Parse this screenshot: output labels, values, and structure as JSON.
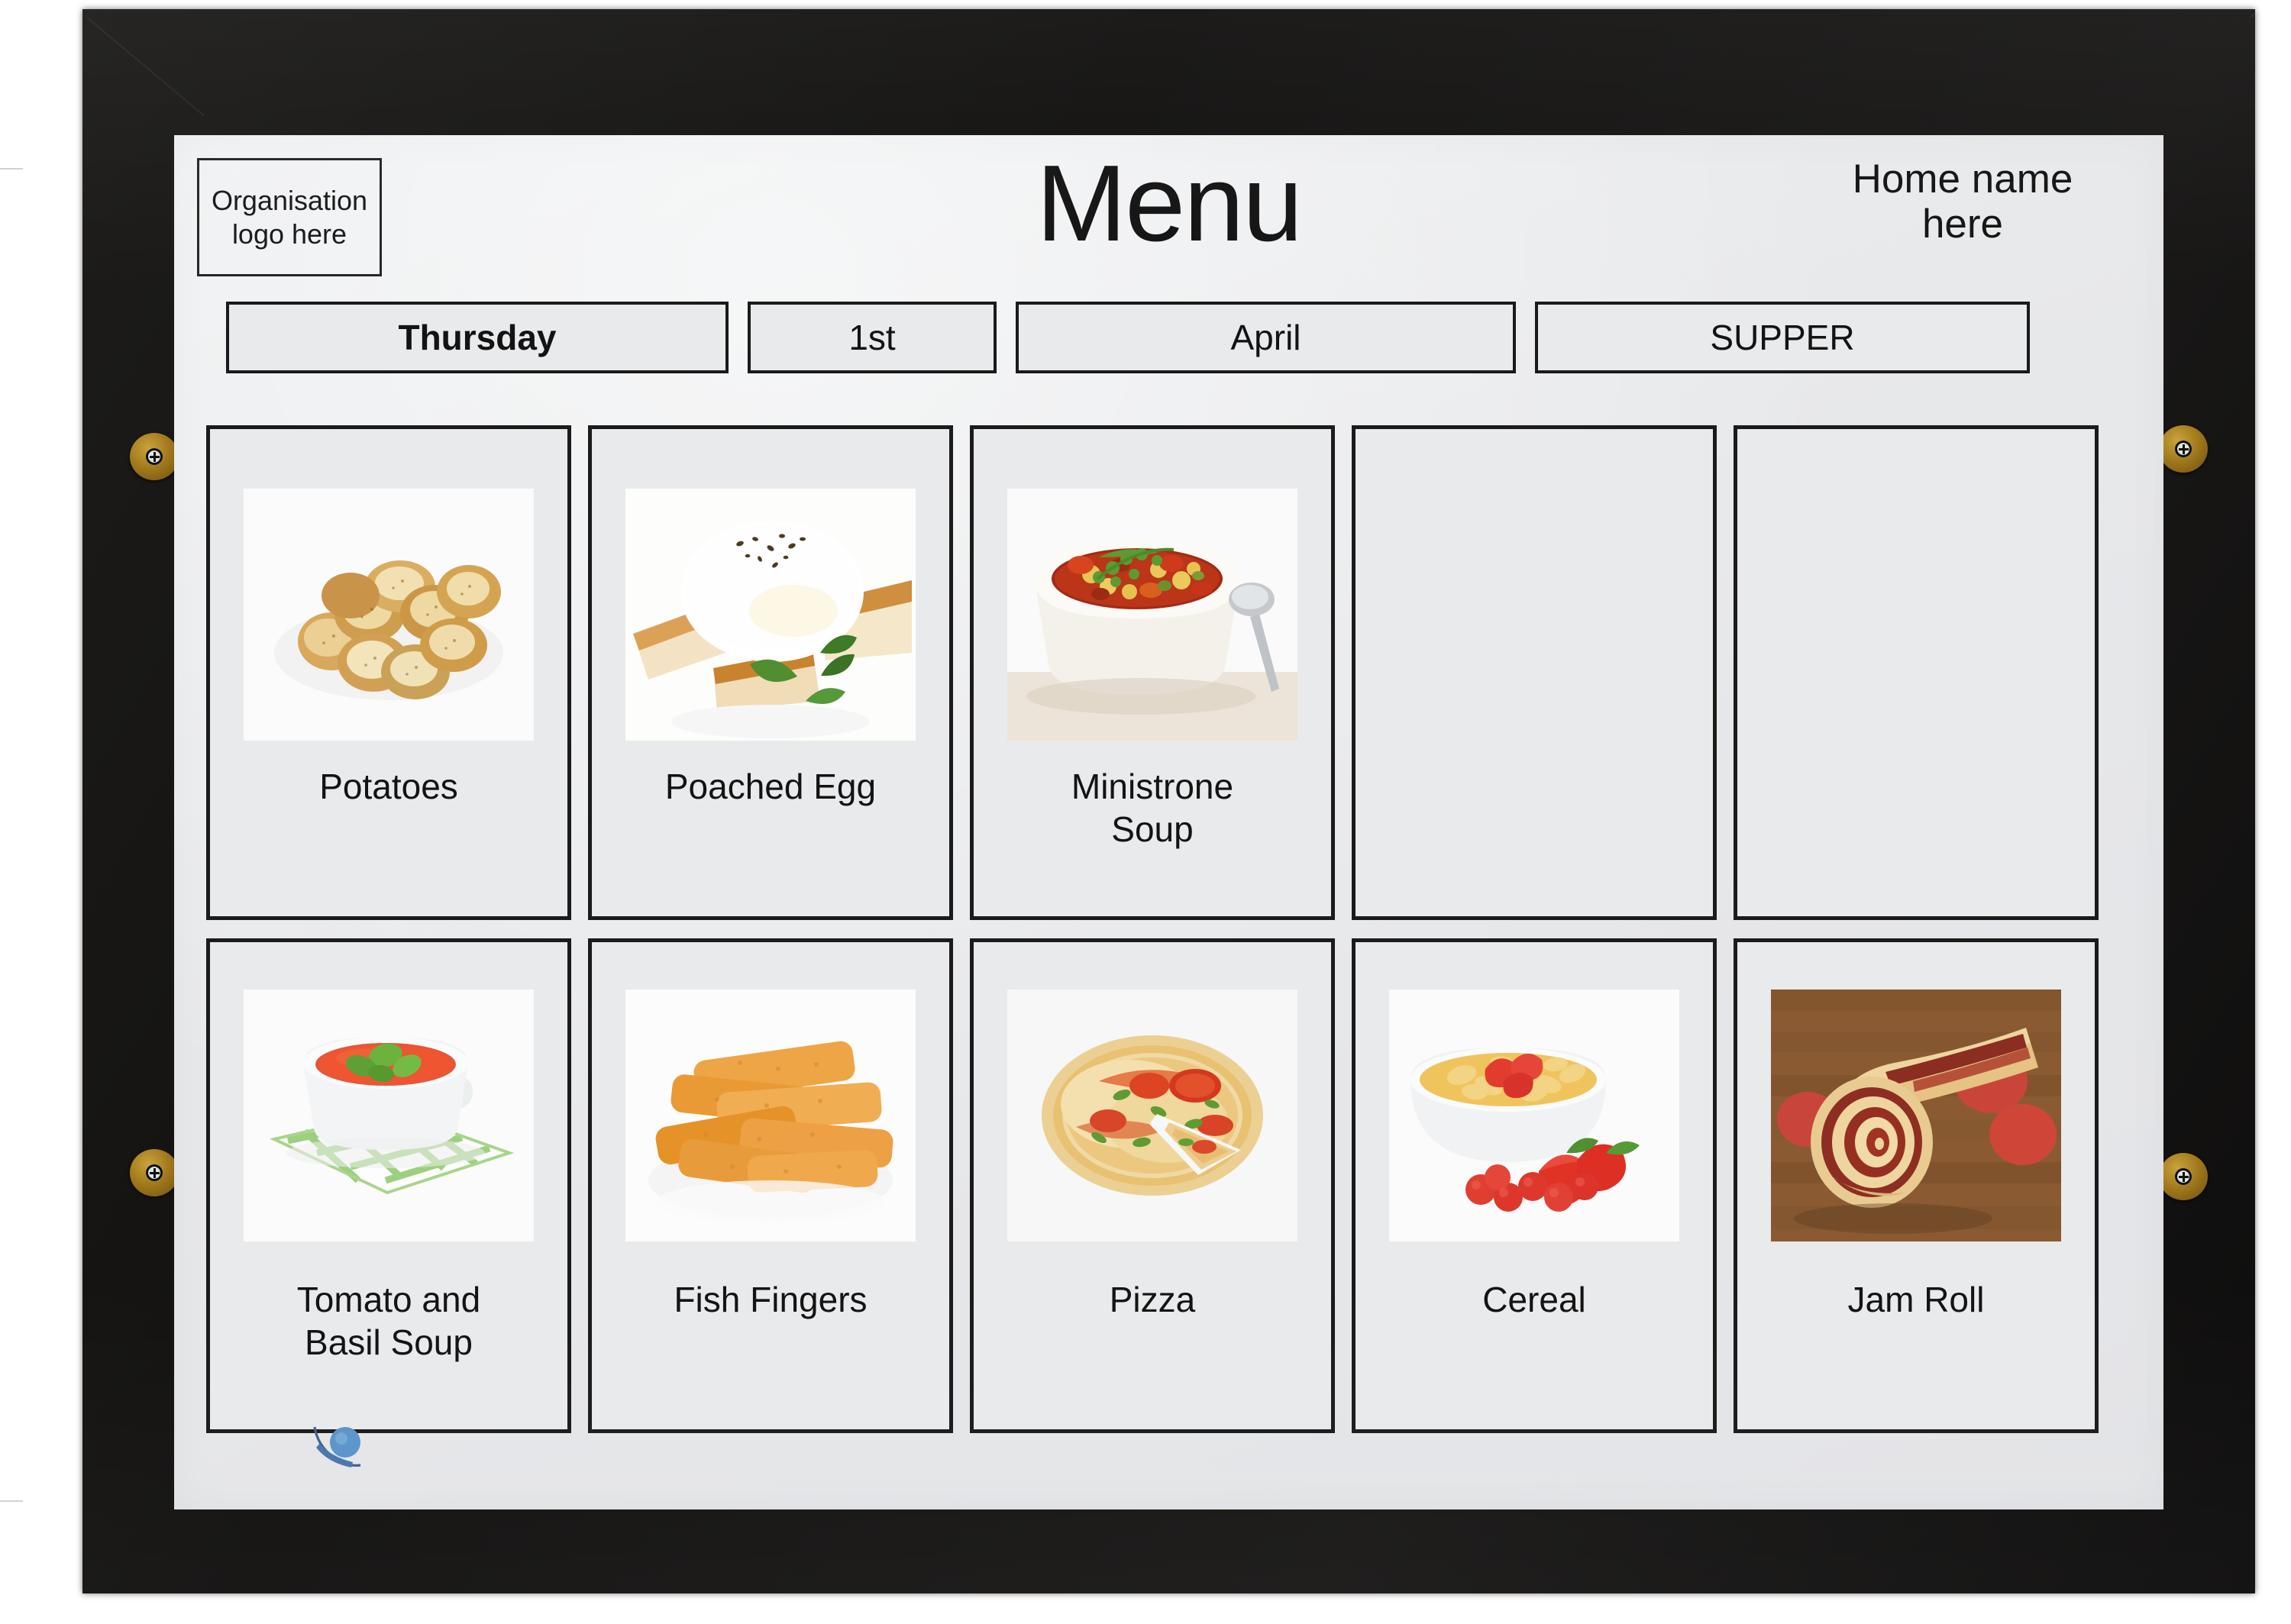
{
  "board": {
    "logo_placeholder_line1": "Organisation",
    "logo_placeholder_line2": "logo here",
    "title": "Menu",
    "home_name_line1": "Home name",
    "home_name_line2": "here"
  },
  "date_row": {
    "day": "Thursday",
    "date": "1st",
    "month": "April",
    "meal": "SUPPER"
  },
  "grid": {
    "rows": [
      {
        "cells": [
          {
            "label": "Potatoes",
            "image": "roast-potatoes-photo",
            "empty": false
          },
          {
            "label": "Poached Egg",
            "image": "poached-egg-photo",
            "empty": false
          },
          {
            "label": "Ministrone\nSoup",
            "label_line1": "Ministrone",
            "label_line2": "Soup",
            "image": "minestrone-soup-photo",
            "empty": false
          },
          {
            "label": "",
            "image": "",
            "empty": true
          },
          {
            "label": "",
            "image": "",
            "empty": true
          }
        ]
      },
      {
        "cells": [
          {
            "label": "Tomato and Basil Soup",
            "label_line1": "Tomato and",
            "label_line2": "Basil Soup",
            "image": "tomato-basil-soup-photo",
            "empty": false
          },
          {
            "label": "Fish Fingers",
            "image": "fish-fingers-photo",
            "empty": false
          },
          {
            "label": "Pizza",
            "image": "pizza-photo",
            "empty": false
          },
          {
            "label": "Cereal",
            "image": "cereal-berries-photo",
            "empty": false
          },
          {
            "label": "Jam Roll",
            "image": "jam-roll-photo",
            "empty": false
          }
        ]
      }
    ]
  },
  "hardware": {
    "clip_count": 4,
    "clip_name": "brass-frame-clip"
  },
  "colors": {
    "frame": "#151413",
    "board": "#e9eaec",
    "ink": "#131313",
    "clip_brass": "#a37b1d",
    "sticker_blue": "#5b93c9"
  }
}
